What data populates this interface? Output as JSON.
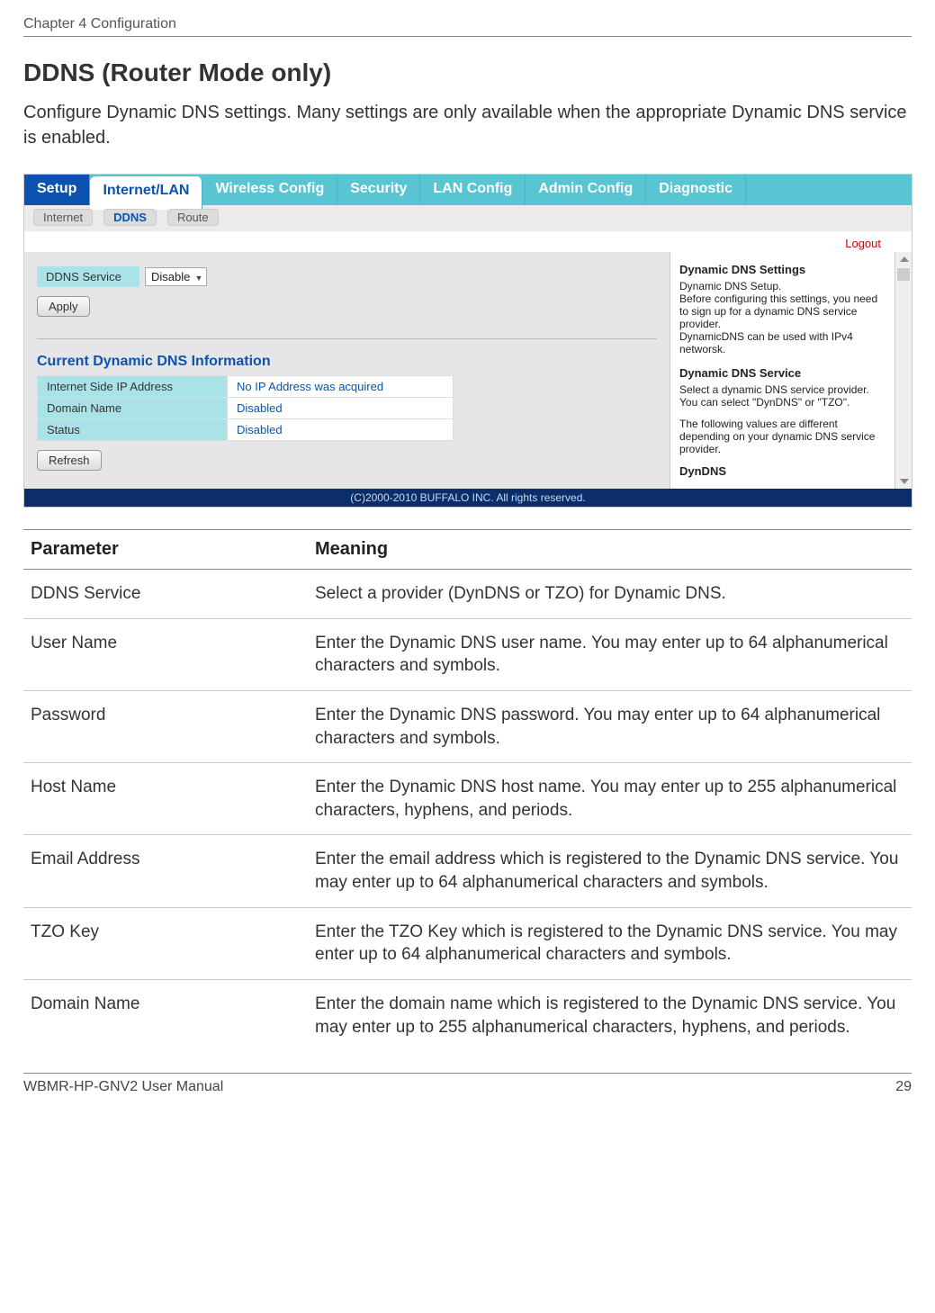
{
  "header": {
    "chapter": "Chapter 4  Configuration"
  },
  "title": "DDNS (Router Mode only)",
  "intro": "Configure Dynamic DNS settings.  Many settings are only available when the appropriate Dynamic DNS service is enabled.",
  "ui": {
    "tabs": [
      "Setup",
      "Internet/LAN",
      "Wireless Config",
      "Security",
      "LAN Config",
      "Admin Config",
      "Diagnostic"
    ],
    "subtabs": [
      "Internet",
      "DDNS",
      "Route"
    ],
    "logout": "Logout",
    "ddns_label": "DDNS Service",
    "ddns_value": "Disable",
    "apply_btn": "Apply",
    "current_title": "Current Dynamic DNS Information",
    "info_rows": [
      {
        "label": "Internet Side IP Address",
        "value": "No IP Address was acquired"
      },
      {
        "label": "Domain Name",
        "value": "Disabled"
      },
      {
        "label": "Status",
        "value": "Disabled"
      }
    ],
    "refresh_btn": "Refresh",
    "right_panel": {
      "h1": "Dynamic DNS Settings",
      "p1": "Dynamic DNS Setup.\nBefore configuring this settings, you need to sign up for a dynamic DNS service provider.\nDynamicDNS can be used with IPv4 networsk.",
      "h2": "Dynamic DNS Service",
      "p2": "Select a dynamic DNS service provider.\nYou can select \"DynDNS\" or \"TZO\".",
      "p3": "The following values are different depending on your dynamic DNS service provider.",
      "cutoff": "DynDNS"
    },
    "copyright": "(C)2000-2010 BUFFALO INC. All rights reserved."
  },
  "param_table": {
    "headers": [
      "Parameter",
      "Meaning"
    ],
    "rows": [
      {
        "param": "DDNS Service",
        "meaning": "Select a provider (DynDNS or TZO) for Dynamic DNS."
      },
      {
        "param": "User Name",
        "meaning": "Enter the Dynamic DNS user name. You may enter up to 64 alphanumerical characters and symbols."
      },
      {
        "param": "Password",
        "meaning": "Enter the Dynamic DNS password. You may enter up to 64 alphanumerical characters and symbols."
      },
      {
        "param": "Host Name",
        "meaning": "Enter the Dynamic DNS host name. You may enter up to 255 alphanumerical characters, hyphens, and periods."
      },
      {
        "param": "Email Address",
        "meaning": "Enter the email address which is registered to the Dynamic DNS service. You may enter up to 64 alphanumerical characters and symbols."
      },
      {
        "param": "TZO Key",
        "meaning": "Enter the TZO Key which is registered to the Dynamic DNS service. You may enter up to 64 alphanumerical characters and symbols."
      },
      {
        "param": "Domain Name",
        "meaning": "Enter the domain name which is registered to the Dynamic DNS service.  You may enter up to 255 alphanumerical characters, hyphens, and periods."
      }
    ]
  },
  "footer": {
    "manual": "WBMR-HP-GNV2 User Manual",
    "page": "29"
  }
}
